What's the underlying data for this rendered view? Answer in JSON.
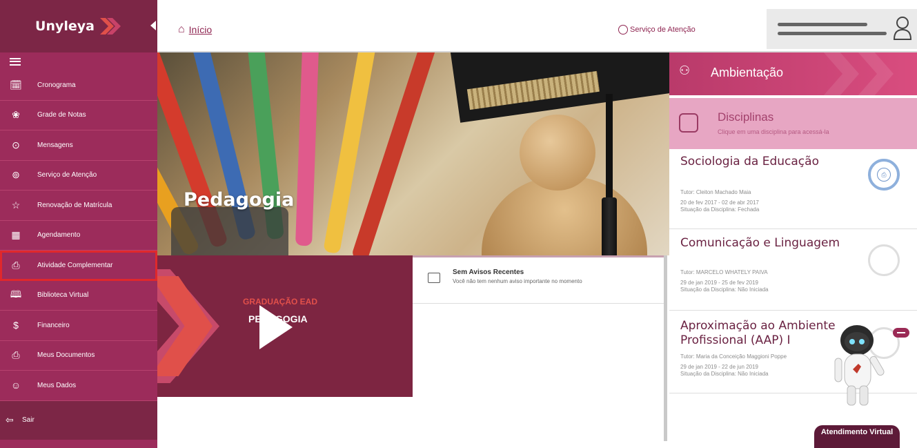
{
  "brand": {
    "name": "Unyleya",
    "primary": "#9c2c5b",
    "dark": "#7c2646",
    "accent": "#e0282c"
  },
  "header": {
    "home_label": "Início",
    "service_label": "Serviço de Atenção"
  },
  "sidebar": {
    "items": [
      {
        "label": "Cronograma",
        "icon": "calendar-icon"
      },
      {
        "label": "Grade de Notas",
        "icon": "award-icon"
      },
      {
        "label": "Mensagens",
        "icon": "chat-bubble-icon"
      },
      {
        "label": "Serviço de Atenção",
        "icon": "support-icon"
      },
      {
        "label": "Renovação de Matrícula",
        "icon": "star-icon"
      },
      {
        "label": "Agendamento",
        "icon": "calendar-grid-icon"
      },
      {
        "label": "Atividade Complementar",
        "icon": "document-badge-icon"
      },
      {
        "label": "Biblioteca Virtual",
        "icon": "book-icon"
      },
      {
        "label": "Financeiro",
        "icon": "money-icon"
      },
      {
        "label": "Meus Documentos",
        "icon": "document-icon"
      },
      {
        "label": "Meus Dados",
        "icon": "user-icon"
      }
    ],
    "logout_label": "Sair"
  },
  "hero": {
    "title": "Pedagogia"
  },
  "video": {
    "subtitle": "GRADUAÇÃO EAD",
    "name": "PEDAGOGIA"
  },
  "avisos": {
    "title": "Sem Avisos Recentes",
    "text": "Você não tem nenhum aviso importante no momento"
  },
  "right_panel": {
    "ambientacao_label": "Ambientação",
    "disciplinas_title": "Disciplinas",
    "disciplinas_sub": "Clique em uma disciplina para acessá-la",
    "courses": [
      {
        "title": "Sociologia da Educação",
        "tutor": "Tutor: Cleiton Machado Maia",
        "dates": "20 de fev 2017 - 02 de abr 2017",
        "status": "Situação da Disciplina: Fechada"
      },
      {
        "title": "Comunicação e Linguagem",
        "tutor": "Tutor: MARCELO WHATELY PAIVA",
        "dates": "29 de jan 2019 - 25 de fev 2019",
        "status": "Situação da Disciplina: Não Iniciada"
      },
      {
        "title": "Aproximação ao Ambiente Profissional (AAP) I",
        "tutor": "Tutor: Maria da Conceição Maggioni Poppe",
        "dates": "29 de jan 2019 - 22 de jun 2019",
        "status": "Situação da Disciplina: Não Iniciada"
      }
    ]
  },
  "chat": {
    "label": "Atendimento Virtual"
  }
}
